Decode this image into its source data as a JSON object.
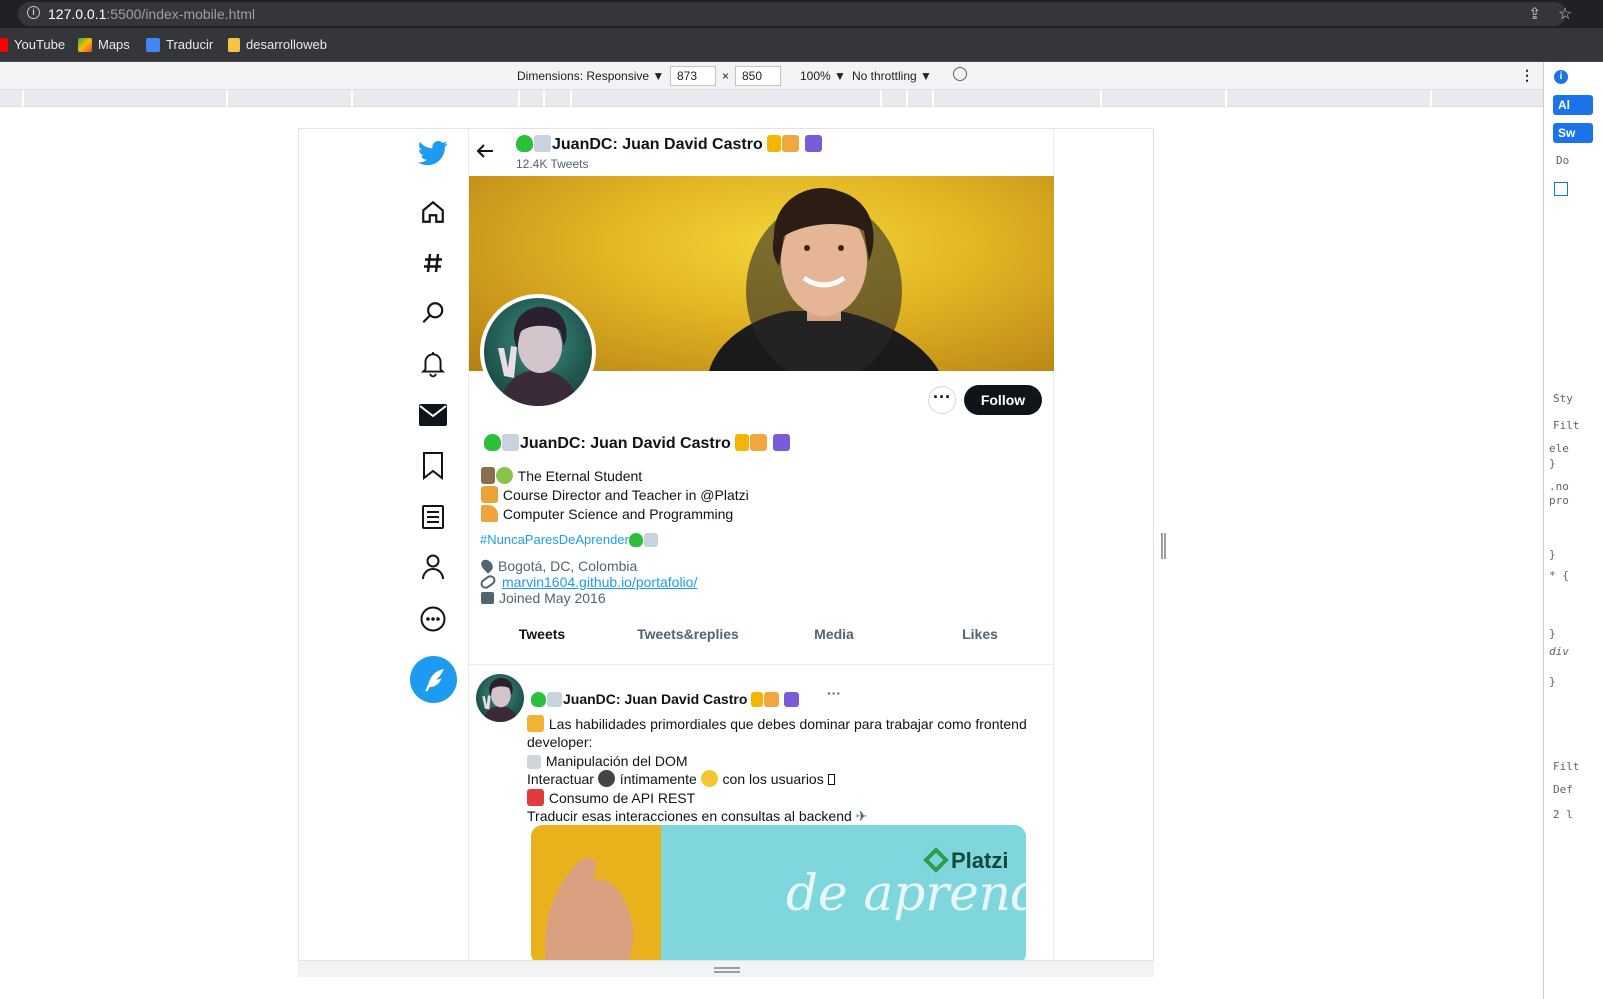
{
  "browser": {
    "url_host": "127.0.0.1",
    "url_path": ":5500/index-mobile.html",
    "bookmarks": [
      "YouTube",
      "Maps",
      "Traducir",
      "desarrolloweb"
    ]
  },
  "devbar": {
    "dimensions_label": "Dimensions: Responsive ▼",
    "width": "873",
    "times": "×",
    "height": "850",
    "zoom": "100% ▼",
    "throttling": "No throttling ▼"
  },
  "devtools": {
    "btn1": "Al",
    "btn2": "Sw",
    "lines": [
      "Do",
      "Sty",
      "Filt",
      "ele",
      "}",
      ".no",
      "pro",
      "}",
      "* {",
      "}",
      "div",
      "}",
      "Filt",
      "Def",
      "2 l"
    ]
  },
  "profile": {
    "top_name": "JuanDC: Juan David Castro",
    "tweet_count": "12.4K Tweets",
    "more_label": "···",
    "follow_label": "Follow",
    "name": "JuanDC: Juan David Castro",
    "bio_lines": [
      "The Eternal Student",
      "Course Director and Teacher in @Platzi",
      "Computer Science and Programming"
    ],
    "hashtag": "#NuncaParesDeAprender",
    "location": "Bogotá, DC, Colombia",
    "website": "marvin1604.github.io/portafolio/",
    "joined": "Joined May 2016"
  },
  "tabs": [
    "Tweets",
    "Tweets&replies",
    "Media",
    "Likes"
  ],
  "tweet": {
    "name": "JuanDC: Juan David Castro",
    "more": "···",
    "lines": [
      "Las habilidades primordiales que debes dominar para trabajar como frontend developer:",
      "Manipulación del DOM",
      "Interactuar",
      "íntimamente",
      "con los usuarios",
      "Consumo de API REST",
      "Traducir esas interacciones en consultas al backend"
    ],
    "media_brand": "Platzi",
    "media_text": "de aprend"
  },
  "colors": {
    "accent": "#1d9bf0",
    "text": "#0f1419",
    "muted": "#536471",
    "banner": "#e3b624"
  }
}
